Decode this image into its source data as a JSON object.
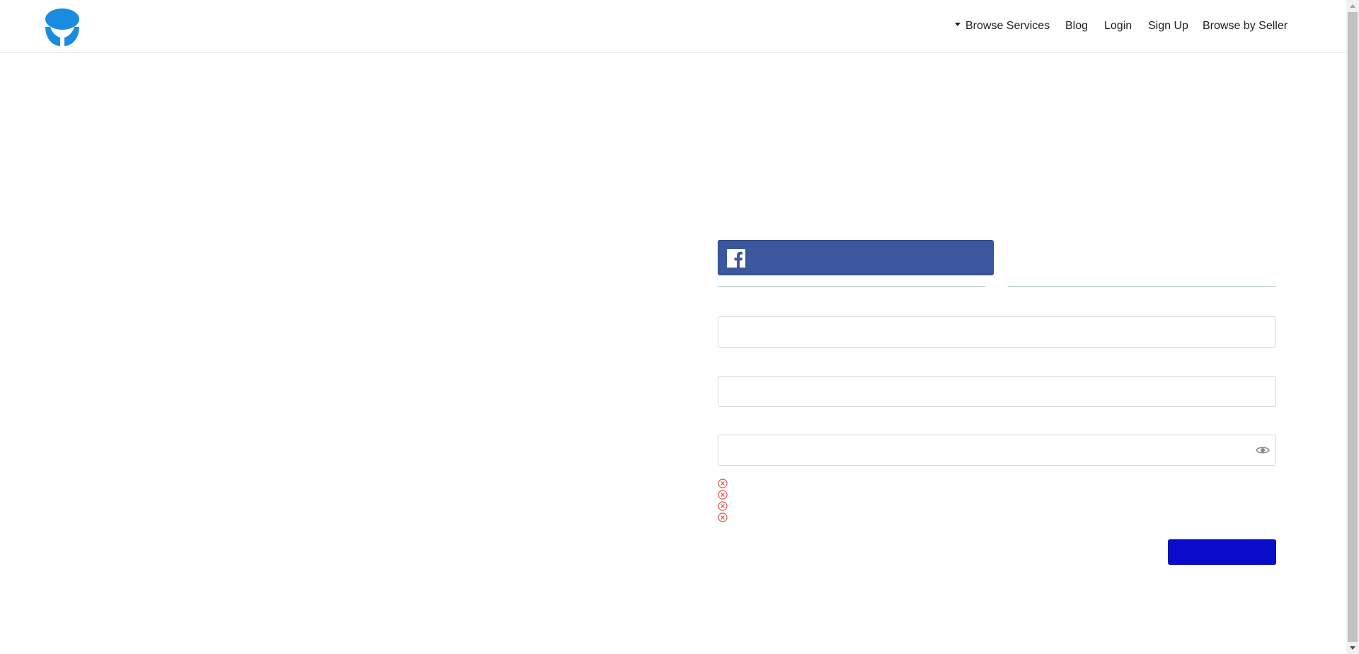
{
  "header": {
    "logo_icon": "brand-logo-icon",
    "nav": {
      "browse_services": "Browse Services",
      "blog": "Blog",
      "login": "Login",
      "sign_up": "Sign Up",
      "browse_by_seller": "Browse by Seller"
    }
  },
  "form": {
    "facebook_icon": "facebook-icon",
    "password_toggle_icon": "eye-icon",
    "requirement_icons": [
      "error-circle-icon",
      "error-circle-icon",
      "error-circle-icon",
      "error-circle-icon"
    ]
  },
  "colors": {
    "brand": "#1a8be0",
    "facebook": "#3b579d",
    "submit": "#0a0ccc",
    "error": "#e05050"
  }
}
